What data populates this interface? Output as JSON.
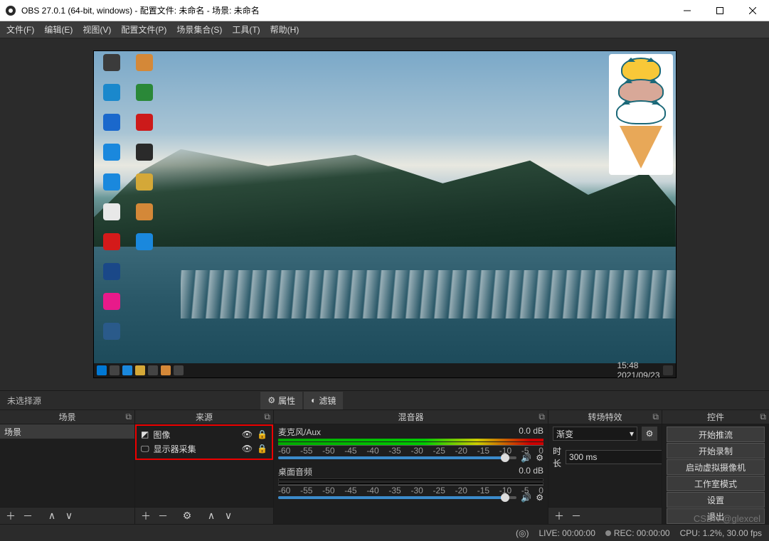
{
  "title": "OBS 27.0.1 (64-bit, windows) - 配置文件: 未命名 - 场景: 未命名",
  "menu": [
    "文件(F)",
    "编辑(E)",
    "视图(V)",
    "配置文件(P)",
    "场景集合(S)",
    "工具(T)",
    "帮助(H)"
  ],
  "propsbar": {
    "no_sel": "未选择源",
    "props": "属性",
    "filters": "滤镜"
  },
  "docks": {
    "scenes": {
      "title": "场景",
      "items": [
        "场景"
      ]
    },
    "sources": {
      "title": "来源",
      "items": [
        {
          "label": "图像",
          "icon": "image"
        },
        {
          "label": "显示器采集",
          "icon": "monitor"
        }
      ]
    },
    "mixer": {
      "title": "混音器",
      "channels": [
        {
          "name": "麦克风/Aux",
          "db": "0.0 dB",
          "meter": 100,
          "vol": 95
        },
        {
          "name": "桌面音频",
          "db": "0.0 dB",
          "meter": 0,
          "vol": 95
        }
      ],
      "ticks": [
        "-60",
        "-55",
        "-50",
        "-45",
        "-40",
        "-35",
        "-30",
        "-25",
        "-20",
        "-15",
        "-10",
        "-5",
        "0"
      ]
    },
    "trans": {
      "title": "转场特效",
      "effect": "渐变",
      "dur_label": "时长",
      "dur": "300 ms"
    },
    "controls": {
      "title": "控件",
      "buttons": [
        "开始推流",
        "开始录制",
        "启动虚拟摄像机",
        "工作室模式",
        "设置",
        "退出"
      ]
    }
  },
  "status": {
    "live": "LIVE: 00:00:00",
    "rec": "REC: 00:00:00",
    "cpu": "CPU: 1.2%, 30.00 fps"
  },
  "taskbar_time": "15:48",
  "taskbar_date": "2021/09/23",
  "watermark": "CSDN @glexcel",
  "desktop_icons": [
    {
      "c": "#3b3b3b"
    },
    {
      "c": "#d48838"
    },
    {
      "c": "#1a88cc"
    },
    {
      "c": "#2a8838"
    },
    {
      "c": "#1a68cc"
    },
    {
      "c": "#cc1a1a"
    },
    {
      "c": "#1a88dd"
    },
    {
      "c": "#2a2a2a"
    },
    {
      "c": "#1a88dd"
    },
    {
      "c": "#d4a838"
    },
    {
      "c": "#e8e8e8"
    },
    {
      "c": "#d48838"
    },
    {
      "c": "#d41a1a"
    },
    {
      "c": "#1a88dd"
    },
    {
      "c": "#1a4888"
    },
    {
      "c": ""
    },
    {
      "c": "#e81a8a"
    },
    {
      "c": ""
    },
    {
      "c": "#2a5a8a"
    },
    {
      "c": ""
    }
  ]
}
